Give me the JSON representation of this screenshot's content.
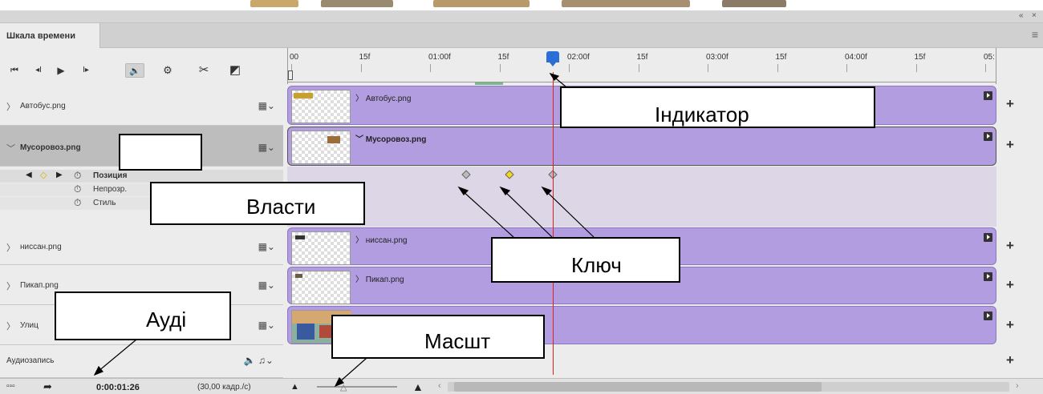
{
  "panel": {
    "tab_label": "Шкала времени",
    "collapse_label": "«",
    "close_label": "×",
    "menu_label": "≡"
  },
  "toolbar": {
    "first_frame": "⏮",
    "prev_frame": "◂I",
    "play": "▶",
    "next_frame": "I▸",
    "audio": "🔈",
    "settings": "⚙",
    "split": "✂",
    "transition": "◩"
  },
  "ruler": {
    "ticks": [
      "00",
      "15f",
      "01:00f",
      "15f",
      "02:00f",
      "15f",
      "03:00f",
      "15f",
      "04:00f",
      "15f",
      "05:"
    ]
  },
  "layers": [
    {
      "name": "Автобус.png",
      "clip": "Автобус.png",
      "expanded": false
    },
    {
      "name": "Мусоровоз.png",
      "clip": "Мусоровоз.png",
      "expanded": true
    },
    {
      "name": "ниссан.png",
      "clip": "ниссан.png",
      "expanded": false
    },
    {
      "name": "Пикап.png",
      "clip": "Пикап.png",
      "expanded": false
    },
    {
      "name": "Улиц",
      "clip": "",
      "expanded": false
    }
  ],
  "properties": [
    {
      "label": "Позиция",
      "animated": true
    },
    {
      "label": "Непрозр.",
      "animated": false
    },
    {
      "label": "Стиль",
      "animated": false
    }
  ],
  "audio_track": {
    "label": "Аудиозапись"
  },
  "bottom": {
    "timecode": "0:00:01:26",
    "fps": "(30,00 кадр./с)"
  },
  "annotations": {
    "indicator": "Індикатор",
    "properties": "Власти",
    "key": "Ключ",
    "audio": "Аудi",
    "scale": "Масшт"
  },
  "colors": {
    "clip": "#b19ddf",
    "playhead": "#e02020",
    "playhead_handle": "#2b6fd6",
    "keyframe_active": "#f2d81c"
  }
}
